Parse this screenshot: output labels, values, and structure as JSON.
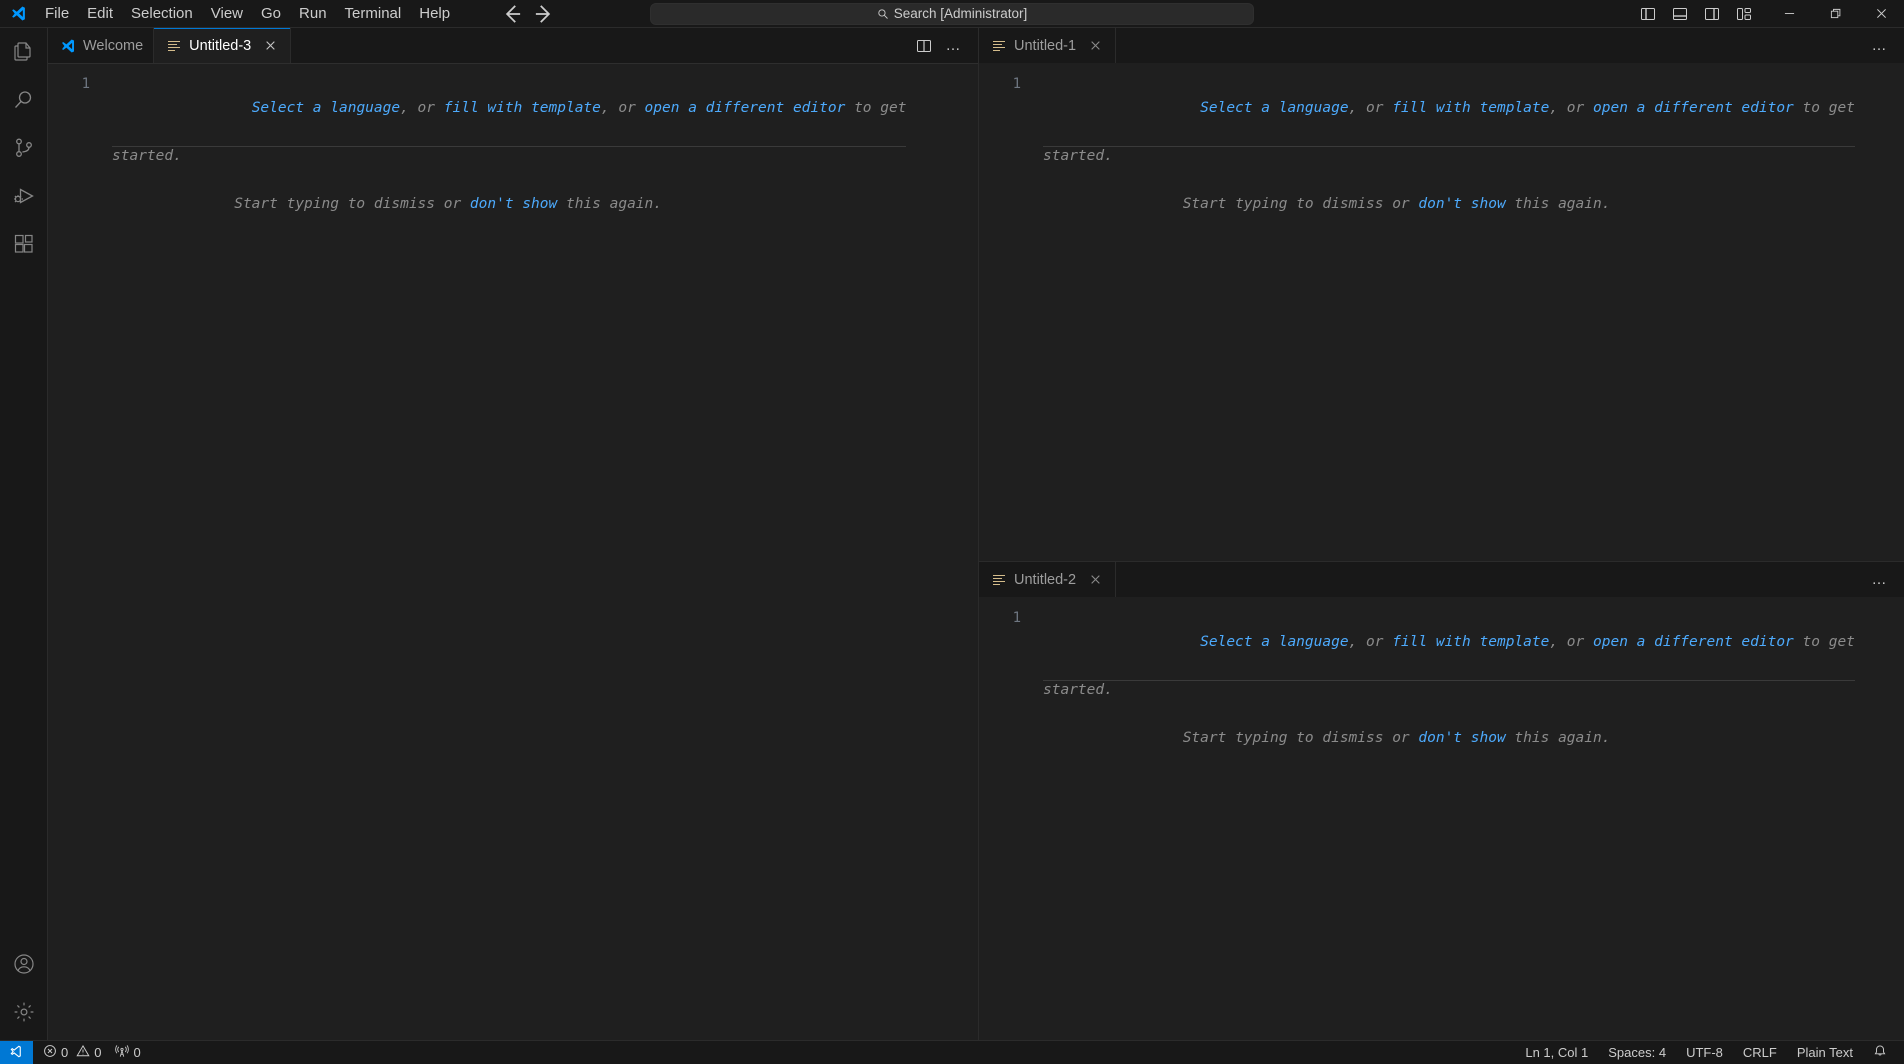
{
  "titlebar": {
    "logo_icon": "vscode-logo-icon",
    "menus": [
      "File",
      "Edit",
      "Selection",
      "View",
      "Go",
      "Run",
      "Terminal",
      "Help"
    ],
    "nav_back_icon": "arrow-left-icon",
    "nav_forward_icon": "arrow-right-icon",
    "command_center": {
      "icon": "search-icon",
      "text": "Search [Administrator]"
    },
    "layout_buttons": [
      {
        "name": "toggle-primary-sidebar",
        "icon": "layout-sidebar-left-icon"
      },
      {
        "name": "toggle-panel",
        "icon": "layout-panel-icon"
      },
      {
        "name": "toggle-secondary-sidebar",
        "icon": "layout-sidebar-right-icon"
      },
      {
        "name": "customize-layout",
        "icon": "layout-customize-icon"
      }
    ],
    "window_controls": [
      {
        "name": "minimize",
        "icon": "minimize-icon"
      },
      {
        "name": "restore",
        "icon": "restore-icon"
      },
      {
        "name": "close",
        "icon": "close-icon"
      }
    ]
  },
  "activitybar": {
    "top": [
      {
        "name": "explorer",
        "icon": "files-icon",
        "label": "Explorer"
      },
      {
        "name": "search",
        "icon": "search-icon",
        "label": "Search"
      },
      {
        "name": "source-control",
        "icon": "source-control-icon",
        "label": "Source Control"
      },
      {
        "name": "run-debug",
        "icon": "run-and-debug-icon",
        "label": "Run and Debug"
      },
      {
        "name": "extensions",
        "icon": "extensions-icon",
        "label": "Extensions"
      }
    ],
    "bottom": [
      {
        "name": "accounts",
        "icon": "account-icon",
        "label": "Accounts"
      },
      {
        "name": "manage",
        "icon": "gear-icon",
        "label": "Manage"
      }
    ]
  },
  "placeholder": {
    "line1_a": "Select a language",
    "line1_b": ", or ",
    "line1_c": "fill with template",
    "line1_d": ", or ",
    "line1_e": "open a different editor",
    "line1_f": " to get",
    "line2": "started.",
    "line3_a": "Start typing to dismiss or ",
    "line3_b": "don't show",
    "line3_c": " this again.",
    "line_number": "1"
  },
  "groups": {
    "left": {
      "tabs": [
        {
          "label": "Welcome",
          "icon": "vscode-logo-icon",
          "active": false,
          "closable": false
        },
        {
          "label": "Untitled-3",
          "icon": "plaintext-file-icon",
          "active": true,
          "closable": true
        }
      ],
      "actions": [
        {
          "name": "split-editor-right",
          "icon": "split-editor-icon"
        },
        {
          "name": "more-actions",
          "icon": "ellipsis-icon",
          "glyph": "…"
        }
      ]
    },
    "top_right": {
      "tabs": [
        {
          "label": "Untitled-1",
          "icon": "plaintext-file-icon",
          "active": false,
          "closable": true
        }
      ],
      "actions": [
        {
          "name": "more-actions",
          "icon": "ellipsis-icon",
          "glyph": "…"
        }
      ]
    },
    "bottom_right": {
      "tabs": [
        {
          "label": "Untitled-2",
          "icon": "plaintext-file-icon",
          "active": false,
          "closable": true
        }
      ],
      "actions": [
        {
          "name": "more-actions",
          "icon": "ellipsis-icon",
          "glyph": "…"
        }
      ]
    }
  },
  "statusbar": {
    "remote_icon": "remote-window-icon",
    "left": [
      {
        "name": "problems",
        "error_icon": "error-icon",
        "error_count": "0",
        "warning_icon": "warning-icon",
        "warning_count": "0"
      },
      {
        "name": "ports",
        "icon": "radio-tower-icon",
        "count": "0"
      }
    ],
    "right": [
      {
        "name": "editor-position",
        "label": "Ln 1, Col 1"
      },
      {
        "name": "editor-indentation",
        "label": "Spaces: 4"
      },
      {
        "name": "editor-encoding",
        "label": "UTF-8"
      },
      {
        "name": "editor-eol",
        "label": "CRLF"
      },
      {
        "name": "editor-language",
        "label": "Plain Text"
      },
      {
        "name": "notifications",
        "icon": "bell-icon"
      }
    ]
  },
  "colors": {
    "titlebar_bg": "#181818",
    "editor_bg": "#1f1f1f",
    "tab_active_border": "#0078d4",
    "link": "#4daafc",
    "status_remote": "#0078d4",
    "text_muted": "#8b8b8b"
  }
}
